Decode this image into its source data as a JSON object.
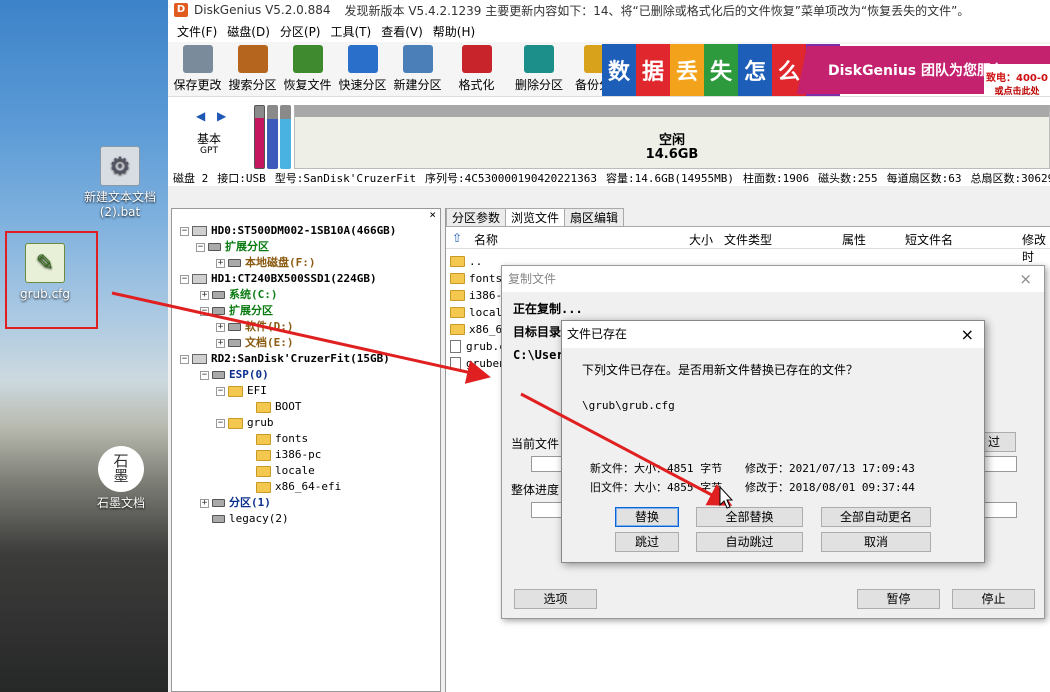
{
  "desktop": {
    "icons": [
      {
        "label": "新建文本文档 (2).bat"
      },
      {
        "label": "grub.cfg"
      },
      {
        "label": "石墨文档",
        "glyph": "石\n墨"
      }
    ]
  },
  "app": {
    "title": "DiskGenius V5.2.0.884",
    "update_notice": "发现新版本 V5.4.2.1239 主要更新内容如下：14、将“已删除或格式化后的文件恢复”菜单项改为“恢复丢失的文件”。",
    "menu": [
      "文件(F)",
      "磁盘(D)",
      "分区(P)",
      "工具(T)",
      "查看(V)",
      "帮助(H)"
    ],
    "toolbar": [
      {
        "label": "保存更改",
        "color": "#7a8b9c"
      },
      {
        "label": "搜索分区",
        "color": "#b5651d"
      },
      {
        "label": "恢复文件",
        "color": "#3f8a2e"
      },
      {
        "label": "快速分区",
        "color": "#2a6fc9"
      },
      {
        "label": "新建分区",
        "color": "#4b7fb8"
      },
      {
        "label": "格式化",
        "color": "#c8242b"
      },
      {
        "label": "删除分区",
        "color": "#1d8f8b"
      },
      {
        "label": "备份分区",
        "color": "#d8a21a"
      }
    ],
    "banner": {
      "chars": [
        "数",
        "据",
        "丢",
        "失",
        "怎",
        "么",
        "办"
      ],
      "char_colors": [
        "#1d5fb8",
        "#e0272d",
        "#f2a31b",
        "#2e9a3e",
        "#1d5fb8",
        "#e0272d",
        "#7d2fa8"
      ],
      "slogan": "DiskGenius 团队为您服务",
      "phone": "致电：400-0",
      "phone_sub": "或点击此处"
    },
    "diskmap": {
      "nav": "◀ ▶",
      "type": "基本",
      "type_sub": "GPT",
      "free_label": "空闲",
      "free_size": "14.6GB"
    },
    "info": [
      "磁盘 2",
      "接口:USB",
      "型号:SanDisk'CruzerFit",
      "序列号:4C530000190420221363",
      "容量:14.6GB(14955MB)",
      "柱面数:1906",
      "磁头数:255",
      "每道扇区数:63",
      "总扇区数:30629"
    ],
    "tree": {
      "close": "×",
      "rows": [
        {
          "text": "HD0:ST500DM002-1SB10A(466GB)"
        },
        {
          "text": "扩展分区"
        },
        {
          "text": "本地磁盘(F:)"
        },
        {
          "text": "HD1:CT240BX500SSD1(224GB)"
        },
        {
          "text": "系统(C:)"
        },
        {
          "text": "扩展分区"
        },
        {
          "text": "软件(D:)"
        },
        {
          "text": "文档(E:)"
        },
        {
          "text": "RD2:SanDisk'CruzerFit(15GB)"
        },
        {
          "text": "ESP(0)"
        },
        {
          "text": "EFI"
        },
        {
          "text": "BOOT"
        },
        {
          "text": "grub"
        },
        {
          "text": "fonts"
        },
        {
          "text": "i386-pc"
        },
        {
          "text": "locale"
        },
        {
          "text": "x86_64-efi"
        },
        {
          "text": "分区(1)"
        },
        {
          "text": "legacy(2)"
        }
      ]
    },
    "tabs": [
      "分区参数",
      "浏览文件",
      "扇区编辑"
    ],
    "columns": [
      "名称",
      "大小",
      "文件类型",
      "属性",
      "短文件名",
      "修改时"
    ],
    "files": [
      "..",
      "fonts",
      "i386-p",
      "locale",
      "x86_64",
      "grub.c",
      "gruben"
    ]
  },
  "copy_dialog": {
    "title": "复制文件",
    "close": "×",
    "status": "正在复制...",
    "target_label": "目标目录",
    "target_path": "C:\\User",
    "current_label": "当前文件",
    "overall_label": "整体进度",
    "skip_button_partial": "过",
    "options_button": "选项",
    "pause_button": "暂停",
    "stop_button": "停止"
  },
  "exist_dialog": {
    "title": "文件已存在",
    "close": "×",
    "message": "下列文件已存在。是否用新文件替换已存在的文件？",
    "path": "\\grub\\grub.cfg",
    "new_file": "新文件：大小：4851 字节",
    "new_mod": "修改于：2021/07/13 17:09:43",
    "old_file": "旧文件：大小：4855 字节",
    "old_mod": "修改于：2018/08/01 09:37:44",
    "buttons": {
      "replace": "替换",
      "replace_all": "全部替换",
      "auto_rename_all": "全部自动更名",
      "skip": "跳过",
      "auto_skip": "自动跳过",
      "cancel": "取消"
    }
  },
  "colors": {
    "annotation_red": "#e02020",
    "esp_pink": "#c51760"
  }
}
